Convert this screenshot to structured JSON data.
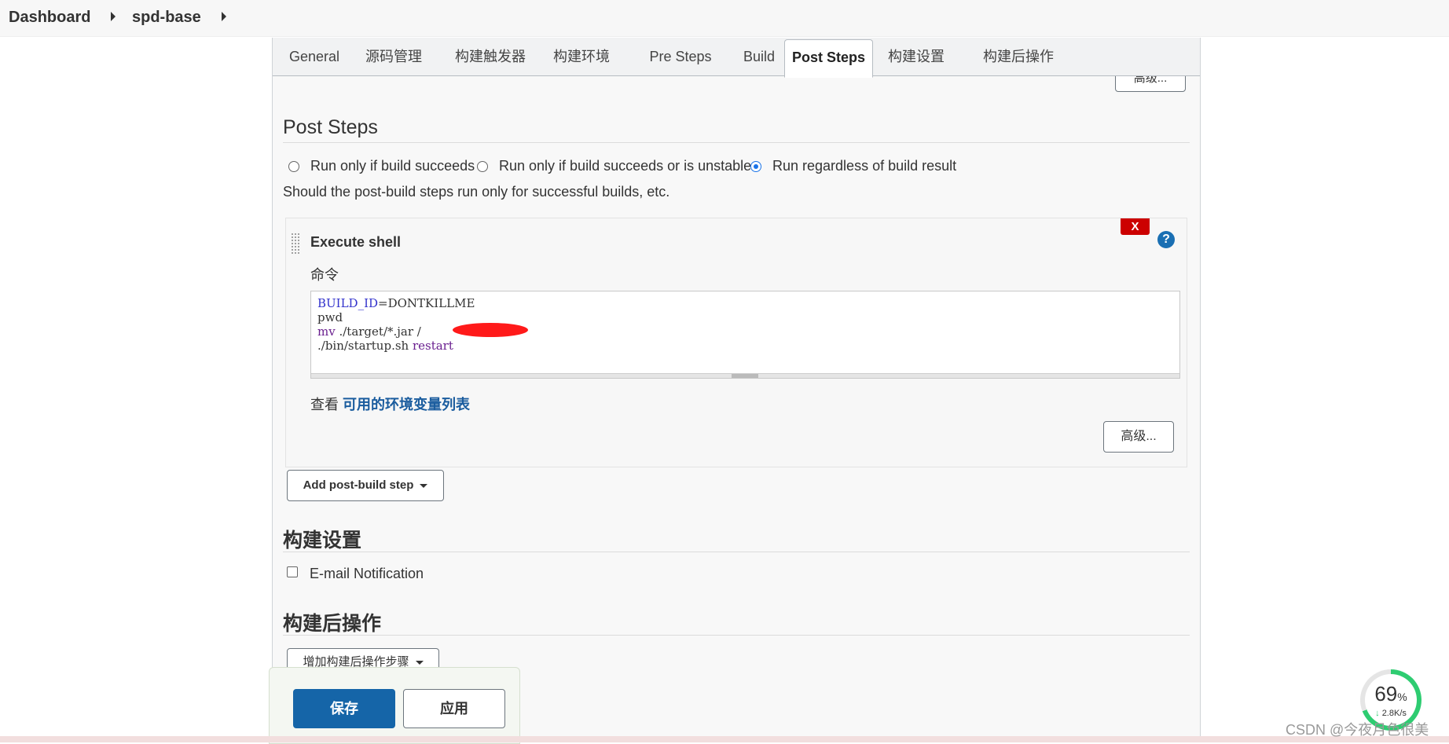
{
  "breadcrumb": {
    "items": [
      "Dashboard",
      "spd-base"
    ]
  },
  "tabs": [
    {
      "label": "General"
    },
    {
      "label": "源码管理"
    },
    {
      "label": "构建触发器"
    },
    {
      "label": "构建环境"
    },
    {
      "label": "Pre Steps"
    },
    {
      "label": "Build"
    },
    {
      "label": "Post Steps",
      "active": true
    },
    {
      "label": "构建设置"
    },
    {
      "label": "构建后操作"
    }
  ],
  "top_advanced_label": "高级...",
  "post_steps": {
    "title": "Post Steps",
    "options": [
      {
        "label": "Run only if build succeeds",
        "selected": false
      },
      {
        "label": "Run only if build succeeds or is unstable",
        "selected": false
      },
      {
        "label": "Run regardless of build result",
        "selected": true
      }
    ],
    "description": "Should the post-build steps run only for successful builds, etc.",
    "step": {
      "delete_label": "X",
      "help_label": "?",
      "title": "Execute shell",
      "command_label": "命令",
      "command_lines": [
        {
          "a": "BUILD_ID",
          "b": "=DONTKILLME"
        },
        {
          "a": "",
          "b": "pwd"
        },
        {
          "a": "mv",
          "b": " ./target/*.jar /",
          "c": "/"
        },
        {
          "a": "",
          "b": "./bin/startup.sh ",
          "c": "restart"
        }
      ],
      "env_prefix": "查看 ",
      "env_link": "可用的环境变量列表",
      "advanced_label": "高级..."
    },
    "add_step_label": "Add post-build step"
  },
  "build_settings": {
    "title": "构建设置",
    "email_label": "E-mail Notification"
  },
  "post_build": {
    "title": "构建后操作",
    "add_label": "增加构建后操作步骤"
  },
  "actions": {
    "save_label": "保存",
    "apply_label": "应用"
  },
  "gauge": {
    "percent": 69,
    "percent_text": "69",
    "percent_unit": "%",
    "speed": "2.8K/s",
    "color": "#2ecc71"
  },
  "watermark": "CSDN @今夜月色很美",
  "colors": {
    "accent": "#1a73e8",
    "primary_button": "#1565a8",
    "delete": "#cc0000",
    "link": "#1a5c9e"
  }
}
